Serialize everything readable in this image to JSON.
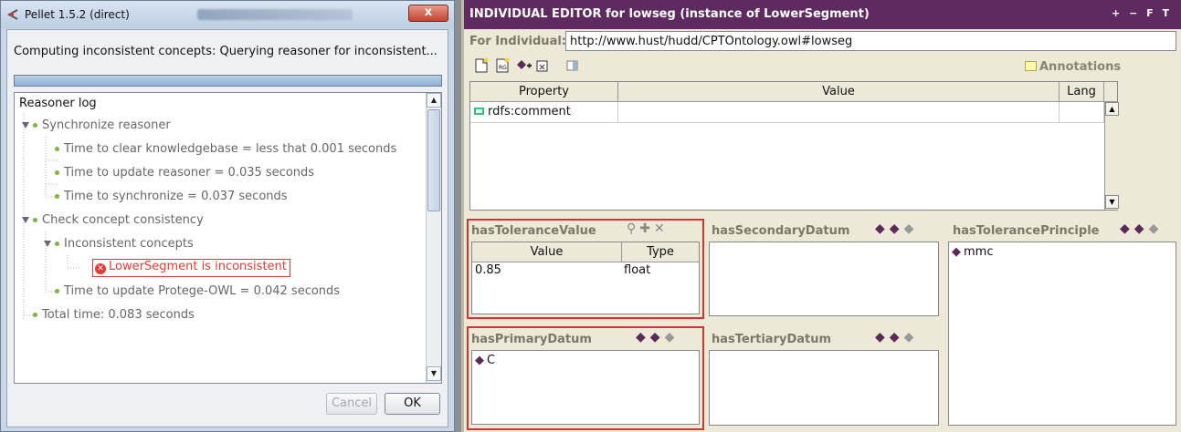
{
  "dialog": {
    "title": "Pellet 1.5.2 (direct)",
    "status": "Computing inconsistent concepts: Querying reasoner for inconsistent...",
    "progress_fraction": 1.0,
    "log": {
      "root": "Reasoner log",
      "items": [
        "Synchronize reasoner",
        "Time to clear knowledgebase = less that 0.001 seconds",
        "Time to update reasoner = 0.035 seconds",
        "Time to synchronize = 0.037 seconds",
        "Check concept consistency",
        "Inconsistent concepts",
        "LowerSegment is inconsistent",
        "Time to update Protege-OWL = 0.042 seconds",
        "Total time: 0.083 seconds"
      ]
    },
    "close_label": "x",
    "cancel_label": "Cancel",
    "ok_label": "OK"
  },
  "editor": {
    "title": "INDIVIDUAL EDITOR for lowseg   (instance of LowerSegment)",
    "title_buttons": "+ − F T",
    "for_label": "For Individual:",
    "for_value": "http://www.hust/hudd/CPTOntology.owl#lowseg",
    "annotations_label": "Annotations",
    "table": {
      "headers": [
        "Property",
        "Value",
        "Lang"
      ],
      "rows": [
        [
          "rdfs:comment",
          "",
          ""
        ]
      ]
    },
    "slots": {
      "tolerance_value": {
        "title": "hasToleranceValue",
        "headers": [
          "Value",
          "Type"
        ],
        "rows": [
          [
            "0.85",
            "float"
          ]
        ]
      },
      "secondary_datum": {
        "title": "hasSecondaryDatum"
      },
      "tolerance_principle": {
        "title": "hasTolerancePrinciple",
        "items": [
          "mmc"
        ]
      },
      "primary_datum": {
        "title": "hasPrimaryDatum",
        "items": [
          "C"
        ]
      },
      "tertiary_datum": {
        "title": "hasTertiaryDatum"
      }
    }
  },
  "colors": {
    "editor_title_bg": "#5f2a5f",
    "error_red": "#e53935",
    "highlight_frame": "#d9312b",
    "tree_dot": "#7ab53c"
  }
}
